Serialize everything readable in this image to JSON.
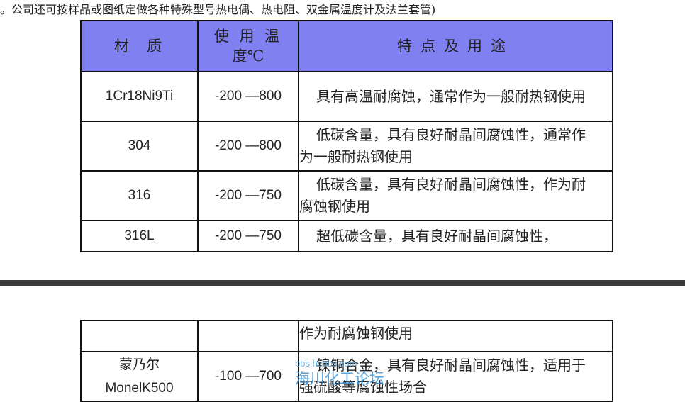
{
  "intro": "。公司还可按样品或图纸定做各种特殊型号热电偶、热电阻、双金属温度计及法兰套管)",
  "header": {
    "material": "材  质",
    "temperature_line1": "使 用 温",
    "temperature_line2": "度℃",
    "usage": "特点及用途"
  },
  "rows": [
    {
      "material": "1Cr18Ni9Ti",
      "temperature": "-200 —800",
      "usage": "具有高温耐腐蚀，通常作为一般耐热钢使用"
    },
    {
      "material": "304",
      "temperature": "-200 —800",
      "usage": "低碳含量，具有良好耐晶间腐蚀性，通常作为一般耐热钢使用"
    },
    {
      "material": "316",
      "temperature": "-200 —750",
      "usage": "低碳含量，具有良好耐晶间腐蚀性，作为耐腐蚀钢使用"
    },
    {
      "material": "316L",
      "temperature": "-200 —750",
      "usage": "超低碳含量，具有良好耐晶间腐蚀性，"
    }
  ],
  "continued": {
    "usage": "作为耐腐蚀钢使用"
  },
  "monel": {
    "material_cn": "蒙乃尔",
    "material_en": "MonelK500",
    "temperature": "-100 —700",
    "usage": "镍铜合金，具有良好耐晶间腐蚀性，适用于强硫酸等腐蚀性场合"
  },
  "watermark": {
    "line1": "bbs.hcbbs.com",
    "line2": "海川化工论坛"
  }
}
